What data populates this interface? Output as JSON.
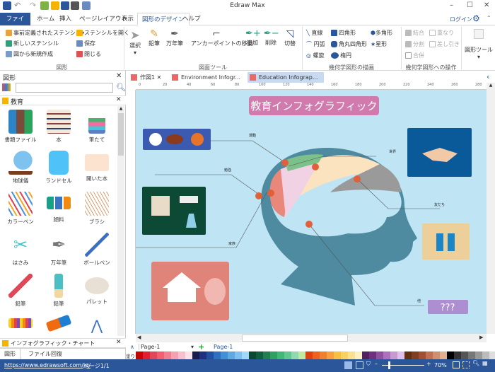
{
  "app": {
    "title": "Edraw Max"
  },
  "quick_access": [
    "app-icon",
    "undo-icon",
    "redo-icon",
    "new-icon",
    "open-icon",
    "save-icon",
    "print-icon",
    "export-icon"
  ],
  "menu_tabs": [
    "ファイル",
    "ホーム",
    "挿入",
    "ページレイアウト",
    "表示",
    "図形のデザイン",
    "ヘルプ"
  ],
  "login": "ログイン",
  "ribbon": {
    "shapes_group": {
      "label": "図形",
      "items": [
        "事前定義されたステンシル",
        "ステンシルを開く",
        "新しいステンシル",
        "保存",
        "図から新規作成",
        "閉じる"
      ]
    },
    "tools_group": {
      "label": "図面ツール",
      "items": [
        "選択",
        "鉛筆",
        "万年筆",
        "アンカーポイントの移動",
        "追加",
        "削除",
        "切替"
      ]
    },
    "geometry_group": {
      "label": "幾何学図形の描画",
      "items": [
        "直線",
        "四角形",
        "多角形",
        "円弧",
        "角丸四角形",
        "星形",
        "螺旋",
        "楕円"
      ]
    },
    "ops_group": {
      "label": "幾何学図形への操作",
      "items": [
        "結合",
        "重なり",
        "分割",
        "差し引き",
        "合併"
      ]
    },
    "shape_tools": "図形ツール"
  },
  "left_panel": {
    "title": "図形",
    "search_placeholder": "",
    "section": "教育",
    "items": [
      "書類ファイル",
      "本",
      "筆たて",
      "地球儀",
      "ランドセル",
      "開いた本",
      "カラーペン",
      "顔料",
      "ブラシ",
      "はさみ",
      "万年筆",
      "ボールペン",
      "鉛筆",
      "鉛筆",
      "パレット"
    ],
    "section2": "インフォグラフィック・チャート",
    "bottom_tabs": [
      "図形",
      "ファイル回復"
    ]
  },
  "doc_tabs": [
    "作図1",
    "Environment Infogr...",
    "Education Infograp..."
  ],
  "ruler_ticks": [
    "0",
    "20",
    "40",
    "60",
    "80",
    "100",
    "120",
    "140",
    "160",
    "180",
    "200",
    "220",
    "240",
    "260",
    "280"
  ],
  "infographic": {
    "title": "教育インフォグラフィック",
    "labels": [
      "運動",
      "勉強",
      "世界",
      "友だち",
      "家族",
      "他"
    ],
    "question": "???"
  },
  "page_bar": {
    "page_select": "Page-1",
    "page_tab": "Page-1",
    "fill_label": "塗りつぶし"
  },
  "status": {
    "url": "https://www.edrawsoft.com/jp/",
    "page": "ページ1/1",
    "zoom": "70%"
  },
  "colors": {
    "accent": "#2b579a",
    "canvas": "#bfe4f4",
    "head": "#4e8ba0",
    "dot": "#e0603a",
    "title_box": "#d07aae"
  }
}
